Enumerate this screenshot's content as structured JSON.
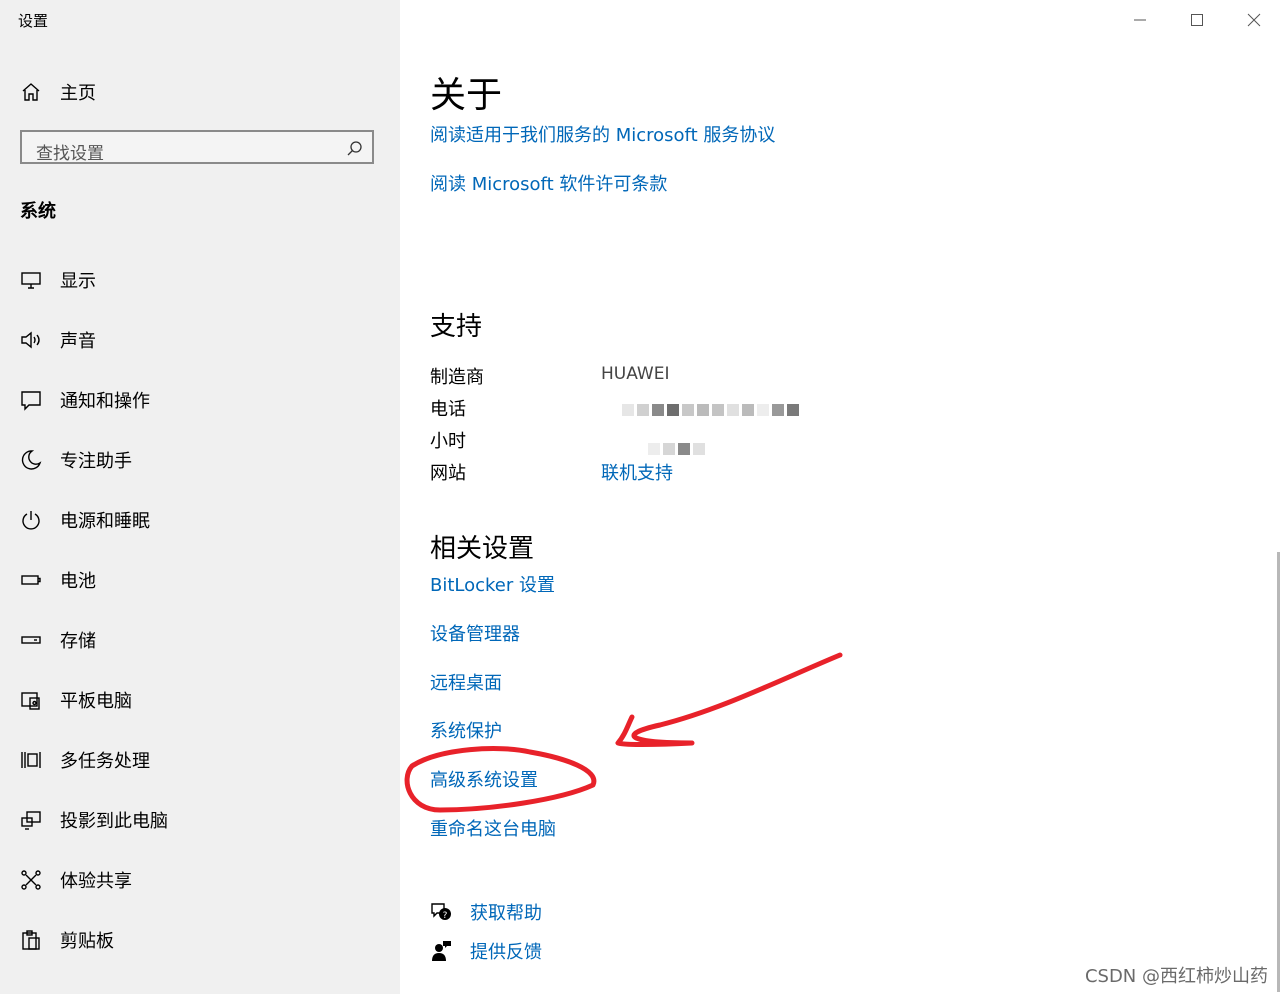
{
  "app": {
    "title": "设置"
  },
  "sidebar": {
    "home_label": "主页",
    "search_placeholder": "查找设置",
    "section_title": "系统",
    "items": [
      {
        "label": "显示",
        "icon": "monitor-icon"
      },
      {
        "label": "声音",
        "icon": "speaker-icon"
      },
      {
        "label": "通知和操作",
        "icon": "notification-icon"
      },
      {
        "label": "专注助手",
        "icon": "moon-icon"
      },
      {
        "label": "电源和睡眠",
        "icon": "power-icon"
      },
      {
        "label": "电池",
        "icon": "battery-icon"
      },
      {
        "label": "存储",
        "icon": "storage-icon"
      },
      {
        "label": "平板电脑",
        "icon": "tablet-icon"
      },
      {
        "label": "多任务处理",
        "icon": "multitask-icon"
      },
      {
        "label": "投影到此电脑",
        "icon": "project-icon"
      },
      {
        "label": "体验共享",
        "icon": "share-icon"
      },
      {
        "label": "剪贴板",
        "icon": "clipboard-icon"
      }
    ]
  },
  "main": {
    "about": {
      "title": "关于",
      "links": [
        "阅读适用于我们服务的 Microsoft 服务协议",
        "阅读 Microsoft 软件许可条款"
      ]
    },
    "support": {
      "title": "支持",
      "manufacturer_label": "制造商",
      "manufacturer_value": "HUAWEI",
      "phone_label": "电话",
      "hours_label": "小时",
      "website_label": "网站",
      "website_link": "联机支持"
    },
    "related": {
      "title": "相关设置",
      "links": [
        "BitLocker 设置",
        "设备管理器",
        "远程桌面",
        "系统保护",
        "高级系统设置",
        "重命名这台电脑"
      ]
    },
    "help": {
      "get_help": "获取帮助",
      "feedback": "提供反馈"
    }
  },
  "watermark": "CSDN @西红柿炒山药",
  "colors": {
    "link": "#0067b8",
    "sidebar_bg": "#f0f0f0",
    "annotation": "#e8222a"
  }
}
